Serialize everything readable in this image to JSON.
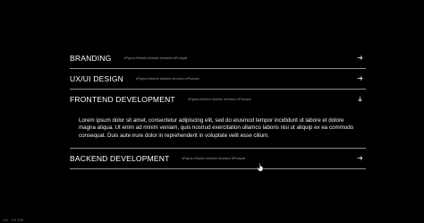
{
  "accordion": {
    "items": [
      {
        "title": "BRANDING",
        "tags": "#Figma #Sketch #Adobe #Invision #Protopie",
        "icon": "arrow-right-icon"
      },
      {
        "title": "UX/UI DESIGN",
        "tags": "#Figma #Sketch #Adobe #Invision #Protopie",
        "icon": "arrow-right-icon"
      },
      {
        "title": "FRONTEND DEVELOPMENT",
        "tags": "#Figma #Sketch #Adobe #Invision #Protopie",
        "icon": "arrow-down-icon",
        "expanded": true,
        "body": "Lorem ipsum dolor sit amet, consectetur adipiscing elit, sed do eiusmod tempor incididunt ut labore et dolore magna aliqua. Ut enim ad minim veniam, quis nostrud exercitation ullamco laboris nisi ut aliquip ex ea commodo consequat. Duis aute irure dolor in reprehenderit in voluptate velit esse cillum."
      },
      {
        "title": "BACKEND DEVELOPMENT",
        "tags": "#Figma #Sketch #Adobe #Invision #Protopie",
        "icon": "arrow-right-icon"
      }
    ]
  },
  "footer": {
    "text": "LOL · 101 1/06"
  },
  "colors": {
    "background": "#000000",
    "text": "#ffffff",
    "divider": "#8a8a8a",
    "tags": "#9a9a9a"
  }
}
